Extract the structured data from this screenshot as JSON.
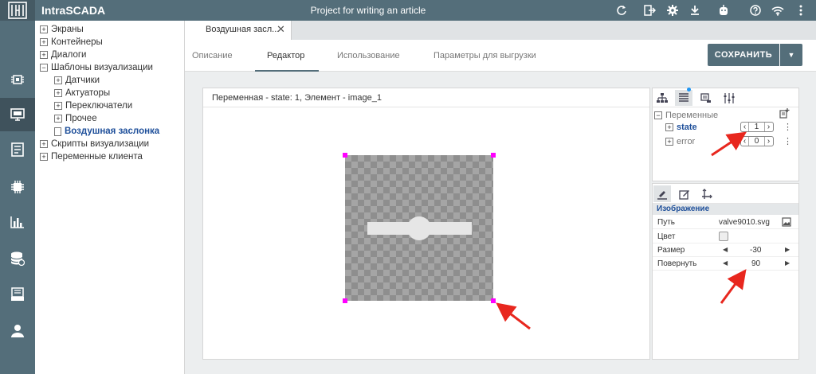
{
  "app": {
    "title": "IntraSCADA",
    "project": "Project for writing an article"
  },
  "colors": {
    "topbar": "#546e7a",
    "accent": "#1e4f9a",
    "handle": "#ff00ff",
    "annotation_arrow": "#e8271e"
  },
  "topbar_icons": [
    "refresh-icon",
    "export-icon",
    "gear-icon",
    "download-icon",
    "robot-icon",
    "help-icon",
    "wifi-icon",
    "more-vertical-icon"
  ],
  "rail_icons": [
    "dashboard-icon",
    "monitor-icon",
    "document-icon",
    "chip-icon",
    "bar-chart-icon",
    "database-icon",
    "archive-icon",
    "user-icon"
  ],
  "tree": {
    "items": [
      {
        "label": "Экраны",
        "toggle": "+"
      },
      {
        "label": "Контейнеры",
        "toggle": "+"
      },
      {
        "label": "Диалоги",
        "toggle": "+"
      },
      {
        "label": "Шаблоны визуализации",
        "toggle": "−"
      },
      {
        "label": "Датчики",
        "toggle": "+"
      },
      {
        "label": "Актуаторы",
        "toggle": "+"
      },
      {
        "label": "Переключатели",
        "toggle": "+"
      },
      {
        "label": "Прочее",
        "toggle": "+"
      },
      {
        "label": "Воздушная заслонка"
      },
      {
        "label": "Скрипты визуализации",
        "toggle": "+"
      },
      {
        "label": "Переменные клиента",
        "toggle": "+"
      }
    ]
  },
  "doc_tab": {
    "label": "Воздушная засл...",
    "close": "✕"
  },
  "subtabs": [
    "Описание",
    "Редактор",
    "Использование",
    "Параметры для выгрузки"
  ],
  "save_button": {
    "label": "СОХРАНИТЬ",
    "arrow": "▼"
  },
  "canvas": {
    "header": "Переменная - state: 1, Элемент - image_1"
  },
  "variables": {
    "header": "Переменные",
    "collapse": "−",
    "items": [
      {
        "name": "state",
        "value": "1",
        "toggle": "+"
      },
      {
        "name": "error",
        "value": "0",
        "toggle": "+"
      }
    ],
    "spin_left": "‹",
    "spin_right": "›",
    "kebab": "⋮"
  },
  "properties": {
    "section": "Изображение",
    "rows": [
      {
        "label": "Путь",
        "value": "valve9010.svg"
      },
      {
        "label": "Цвет",
        "value": ""
      },
      {
        "label": "Размер",
        "value": "-30"
      },
      {
        "label": "Повернуть",
        "value": "90"
      }
    ],
    "tri_left": "◀",
    "tri_right": "▶"
  }
}
